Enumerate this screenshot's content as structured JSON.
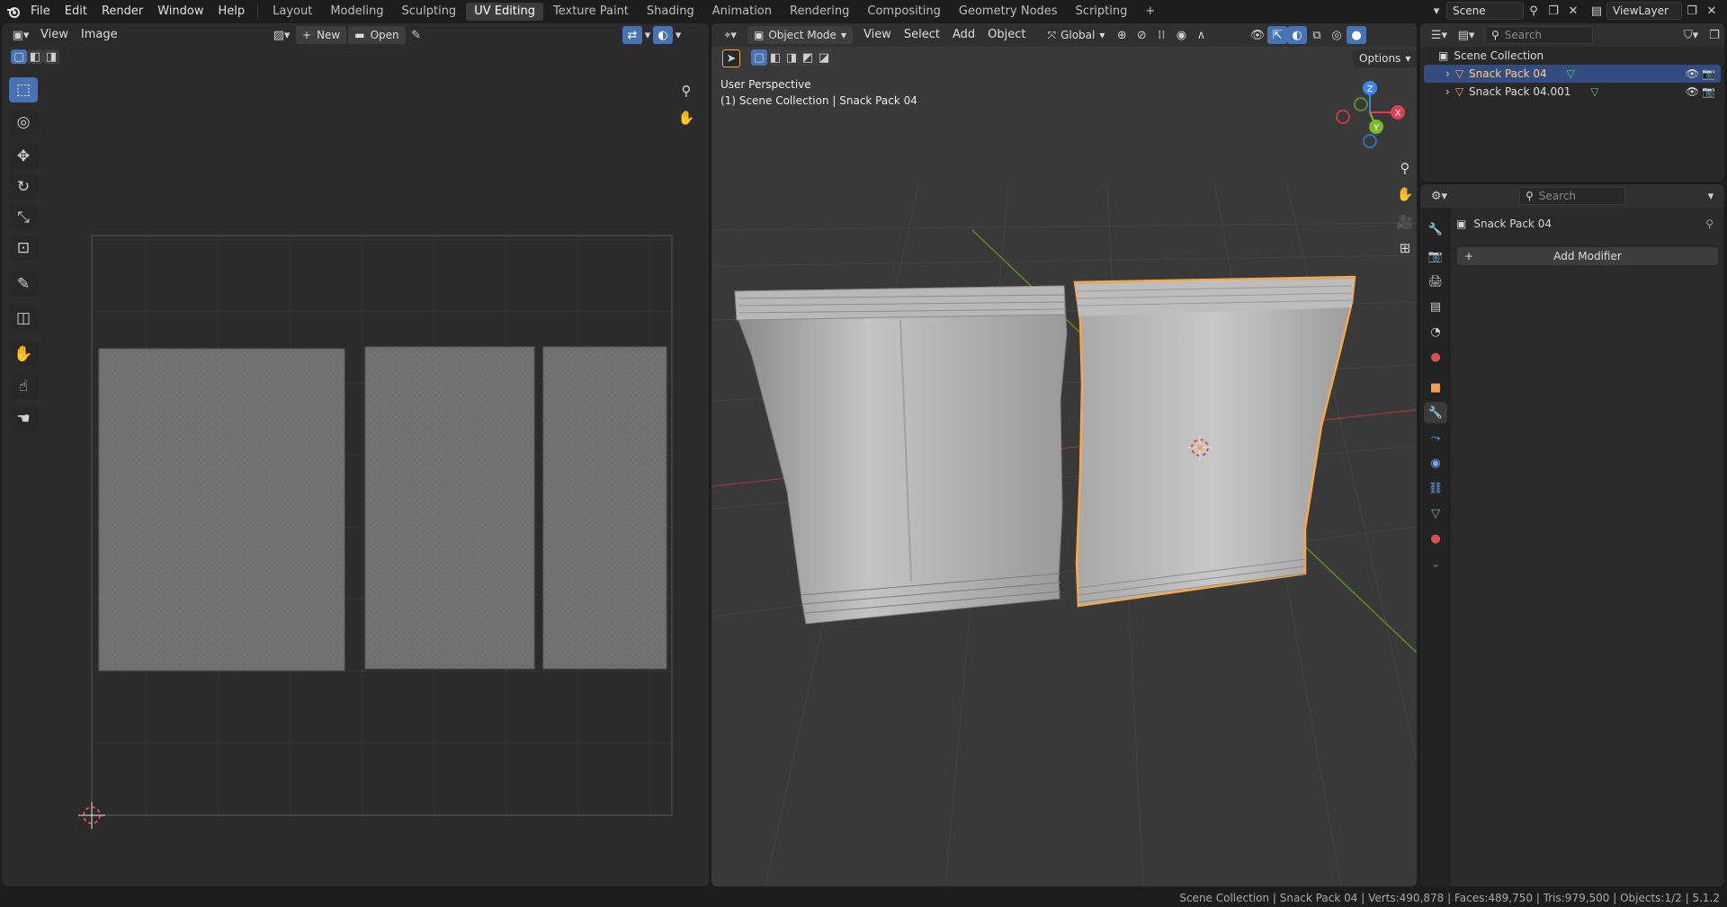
{
  "topbar": {
    "menus": [
      "File",
      "Edit",
      "Render",
      "Window",
      "Help"
    ],
    "workspaces": [
      "Layout",
      "Modeling",
      "Sculpting",
      "UV Editing",
      "Texture Paint",
      "Shading",
      "Animation",
      "Rendering",
      "Compositing",
      "Geometry Nodes",
      "Scripting"
    ],
    "active_workspace": "UV Editing",
    "add_tab": "+",
    "scene_name": "Scene",
    "view_layer": "ViewLayer"
  },
  "uv_editor": {
    "menus": [
      "View",
      "Image"
    ],
    "new_label": "New",
    "open_label": "Open"
  },
  "viewport": {
    "mode": "Object Mode",
    "menus": [
      "View",
      "Select",
      "Add",
      "Object"
    ],
    "orientation": "Global",
    "options_label": "Options",
    "perspective_label": "User Perspective",
    "collection_label": "(1) Scene Collection | Snack Pack 04",
    "gizmo_axes": {
      "x": "X",
      "y": "Y",
      "z": "Z"
    }
  },
  "outliner": {
    "search_placeholder": "Search",
    "root": "Scene Collection",
    "items": [
      {
        "name": "Snack Pack 04",
        "selected": true
      },
      {
        "name": "Snack Pack 04.001",
        "selected": false
      }
    ]
  },
  "properties": {
    "search_placeholder": "Search",
    "object_name": "Snack Pack 04",
    "add_modifier_label": "Add Modifier"
  },
  "statusbar": {
    "text": "Scene Collection | Snack Pack 04 | Verts:490,878 | Faces:489,750 | Tris:979,500 | Objects:1/2 | 5.1.2"
  },
  "colors": {
    "accent": "#4772b3",
    "selection_outline": "#f5a94a",
    "x_axis": "#e0404f",
    "y_axis": "#7cb82a",
    "z_axis": "#3b86e6"
  }
}
